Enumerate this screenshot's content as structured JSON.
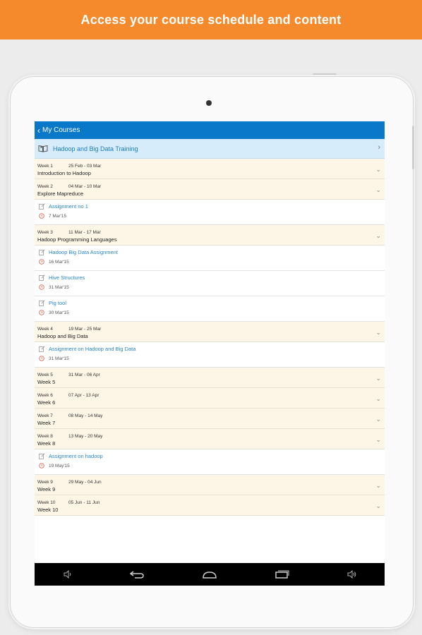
{
  "banner": {
    "text": "Access your course schedule and content"
  },
  "appbar": {
    "back_label": "My Courses"
  },
  "course": {
    "title": "Hadoop and Big Data Training"
  },
  "weeks": [
    {
      "week": "Week 1",
      "dates": "25 Feb - 03 Mar",
      "title": "Introduction to Hadoop",
      "items": []
    },
    {
      "week": "Week 2",
      "dates": "04 Mar - 10 Mar",
      "title": "Explore Mapreduce",
      "items": [
        {
          "title": "Assignment no 1",
          "date": "7 Mar'15"
        }
      ]
    },
    {
      "week": "Week 3",
      "dates": "11 Mar - 17 Mar",
      "title": "Hadoop Programming Languages",
      "items": [
        {
          "title": "Hadoop Big Data Assignment",
          "date": "16 Mar'15"
        },
        {
          "title": "Hive Structures",
          "date": "31 Mar'15"
        },
        {
          "title": "Pig tool",
          "date": "30 Mar'15"
        }
      ]
    },
    {
      "week": "Week 4",
      "dates": "19 Mar - 25 Mar",
      "title": "Hadoop and Big Data",
      "items": [
        {
          "title": "Assignment on Hadoop and Big Data",
          "date": "31 Mar'15"
        }
      ]
    },
    {
      "week": "Week 5",
      "dates": "31 Mar - 06 Apr",
      "title": "Week 5",
      "items": []
    },
    {
      "week": "Week 6",
      "dates": "07 Apr - 13 Apr",
      "title": "Week 6",
      "items": []
    },
    {
      "week": "Week 7",
      "dates": "08 May - 14 May",
      "title": "Week 7",
      "items": []
    },
    {
      "week": "Week 8",
      "dates": "13 May - 20 May",
      "title": "Week 8",
      "items": [
        {
          "title": "Assignment on hadoop",
          "date": "19 May'15"
        }
      ]
    },
    {
      "week": "Week 9",
      "dates": "29 May - 04 Jun",
      "title": "Week 9",
      "items": []
    },
    {
      "week": "Week 10",
      "dates": "05 Jun - 11 Jun",
      "title": "Week 10",
      "items": []
    }
  ],
  "navbar": {
    "buttons": [
      "volume-down-icon",
      "back-icon",
      "home-icon",
      "recents-icon",
      "volume-up-icon"
    ]
  },
  "colors": {
    "banner": "#f58a2c",
    "appbar": "#0a78c8",
    "course_row": "#d6ecfa",
    "week_row": "#fdf6e6",
    "link": "#2a86c9",
    "due_clock": "#e26a5a"
  }
}
